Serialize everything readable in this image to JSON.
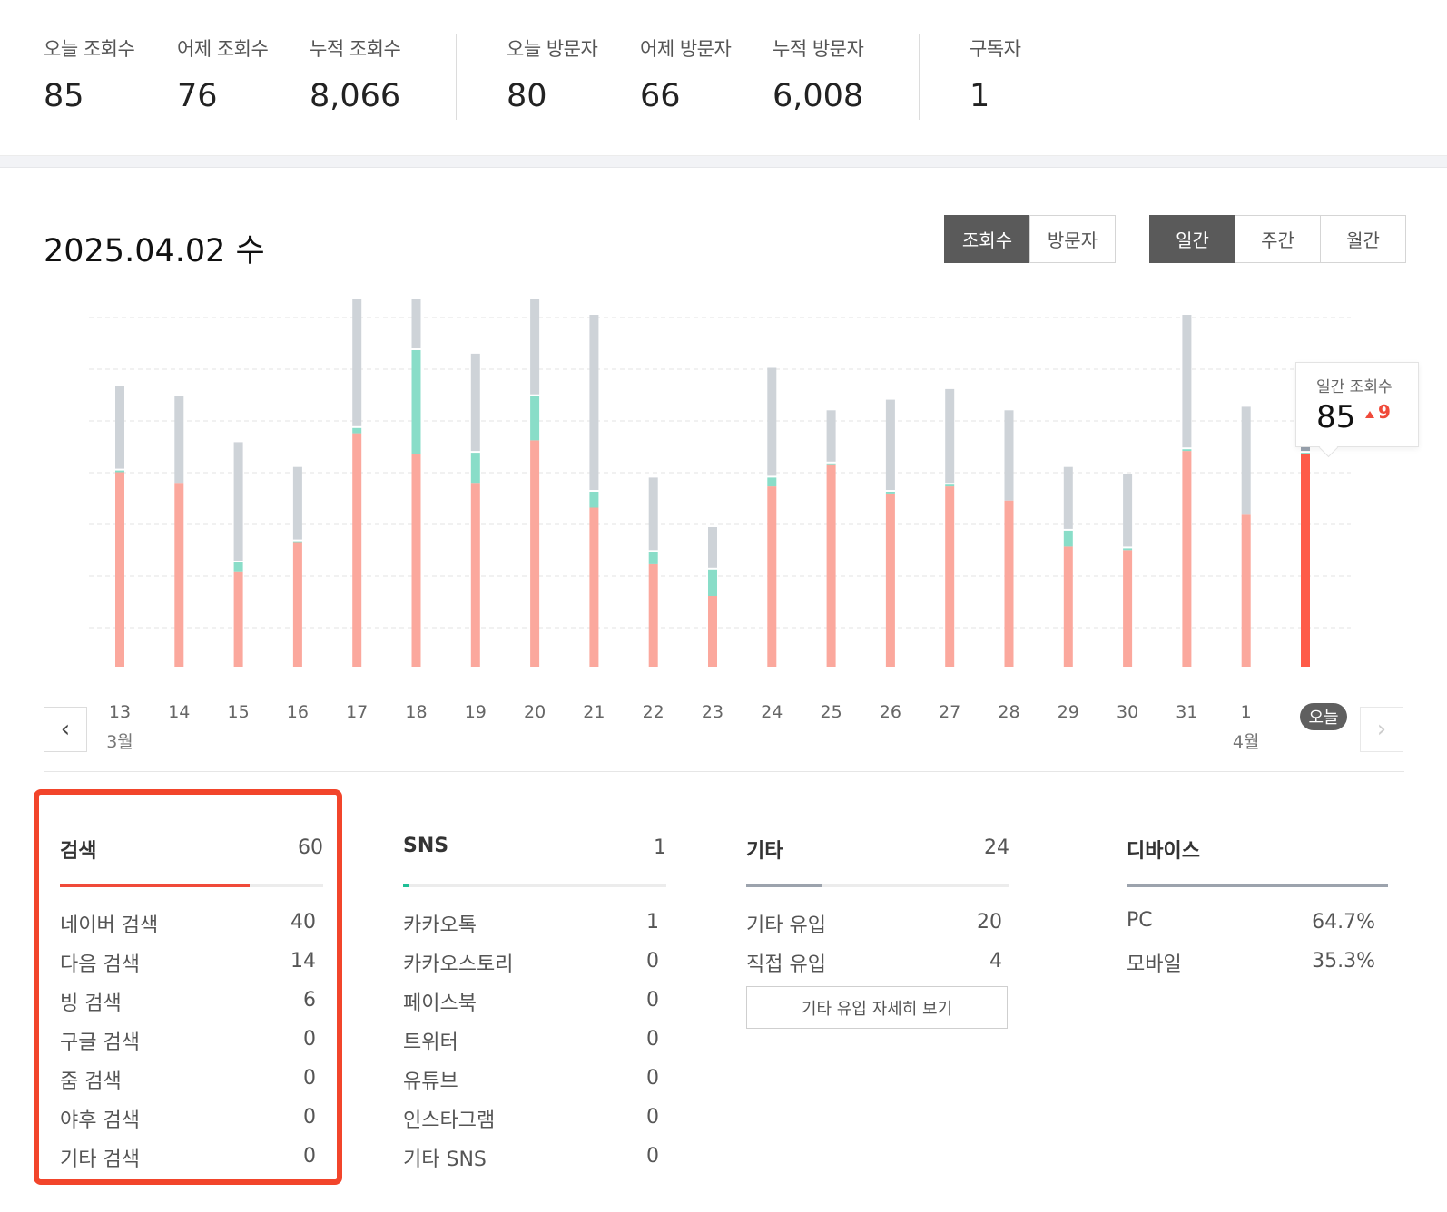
{
  "stats": {
    "today_views": {
      "label": "오늘 조회수",
      "value": "85"
    },
    "yesterday_views": {
      "label": "어제 조회수",
      "value": "76"
    },
    "total_views": {
      "label": "누적 조회수",
      "value": "8,066"
    },
    "today_visitors": {
      "label": "오늘 방문자",
      "value": "80"
    },
    "yesterday_visitors": {
      "label": "어제 방문자",
      "value": "66"
    },
    "total_visitors": {
      "label": "누적 방문자",
      "value": "6,008"
    },
    "subscribers": {
      "label": "구독자",
      "value": "1"
    }
  },
  "header": {
    "date_title": "2025.04.02 수",
    "metric_tabs": [
      "조회수",
      "방문자"
    ],
    "period_tabs": [
      "일간",
      "주간",
      "월간"
    ]
  },
  "tooltip": {
    "label": "일간 조회수",
    "value": "85",
    "change": "9"
  },
  "chart_data": {
    "type": "bar",
    "stacked": true,
    "categories": [
      "13",
      "14",
      "15",
      "16",
      "17",
      "18",
      "19",
      "20",
      "21",
      "22",
      "23",
      "24",
      "25",
      "26",
      "27",
      "28",
      "29",
      "30",
      "31",
      "1",
      "오늘"
    ],
    "month_labels": [
      {
        "index": 0,
        "label": "3월"
      },
      {
        "index": 19,
        "label": "4월"
      }
    ],
    "ylim": [
      0,
      100
    ],
    "grid": true,
    "series": [
      {
        "color": "#fba89d",
        "highlight_color": "#fe5b48",
        "values": [
          55,
          52,
          27,
          35,
          66,
          60,
          52,
          64,
          45,
          29,
          20,
          51,
          57,
          49,
          51,
          47,
          34,
          33,
          61,
          43,
          60
        ]
      },
      {
        "color": "#89ddc8",
        "values": [
          1,
          0,
          3,
          1,
          2,
          30,
          9,
          13,
          5,
          4,
          8,
          3,
          1,
          1,
          1,
          0,
          5,
          1,
          1,
          0,
          1
        ]
      },
      {
        "color": "#ced3d8",
        "highlight_color": "#9ba4b0",
        "values": [
          24,
          25,
          34,
          21,
          48,
          43,
          28,
          36,
          50,
          21,
          12,
          31,
          15,
          26,
          27,
          26,
          18,
          21,
          38,
          31,
          24
        ]
      }
    ]
  },
  "sections": {
    "search": {
      "title": "검색",
      "total": "60",
      "bar_color": "#f04a3a",
      "bar_fraction": 0.72,
      "rows": [
        {
          "label": "네이버 검색",
          "value": "40"
        },
        {
          "label": "다음 검색",
          "value": "14"
        },
        {
          "label": "빙 검색",
          "value": "6"
        },
        {
          "label": "구글 검색",
          "value": "0"
        },
        {
          "label": "줌 검색",
          "value": "0"
        },
        {
          "label": "야후 검색",
          "value": "0"
        },
        {
          "label": "기타 검색",
          "value": "0"
        }
      ]
    },
    "sns": {
      "title": "SNS",
      "total": "1",
      "bar_color": "#1fbf96",
      "bar_fraction": 0.025,
      "rows": [
        {
          "label": "카카오톡",
          "value": "1"
        },
        {
          "label": "카카오스토리",
          "value": "0"
        },
        {
          "label": "페이스북",
          "value": "0"
        },
        {
          "label": "트위터",
          "value": "0"
        },
        {
          "label": "유튜브",
          "value": "0"
        },
        {
          "label": "인스타그램",
          "value": "0"
        },
        {
          "label": "기타 SNS",
          "value": "0"
        }
      ]
    },
    "etc": {
      "title": "기타",
      "total": "24",
      "bar_color": "#9ca3ad",
      "bar_fraction": 0.29,
      "rows": [
        {
          "label": "기타 유입",
          "value": "20"
        },
        {
          "label": "직접 유입",
          "value": "4"
        }
      ],
      "detail_button": "기타 유입 자세히 보기"
    },
    "device": {
      "title": "디바이스",
      "total": "",
      "bar_color": "#9ca3ad",
      "bar_fraction": 1.0,
      "rows": [
        {
          "label": "PC",
          "value": "64.7%"
        },
        {
          "label": "모바일",
          "value": "35.3%"
        }
      ]
    }
  }
}
